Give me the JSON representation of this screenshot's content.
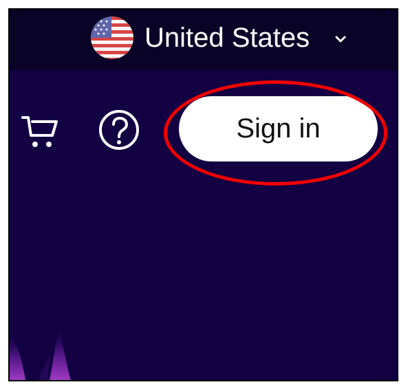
{
  "header": {
    "country_selector": {
      "label": "United States",
      "flag_icon": "us-flag-icon",
      "dropdown_icon": "chevron-down-icon"
    },
    "cart_icon": "shopping-cart-icon",
    "help_icon": "help-circle-icon",
    "sign_in_label": "Sign in"
  },
  "colors": {
    "top_strip": "#090427",
    "hero_background": "#120042",
    "button_background": "#ffffff",
    "button_text": "#111111",
    "highlight_ring": "#f20000",
    "glow": "#8f2bb8"
  }
}
